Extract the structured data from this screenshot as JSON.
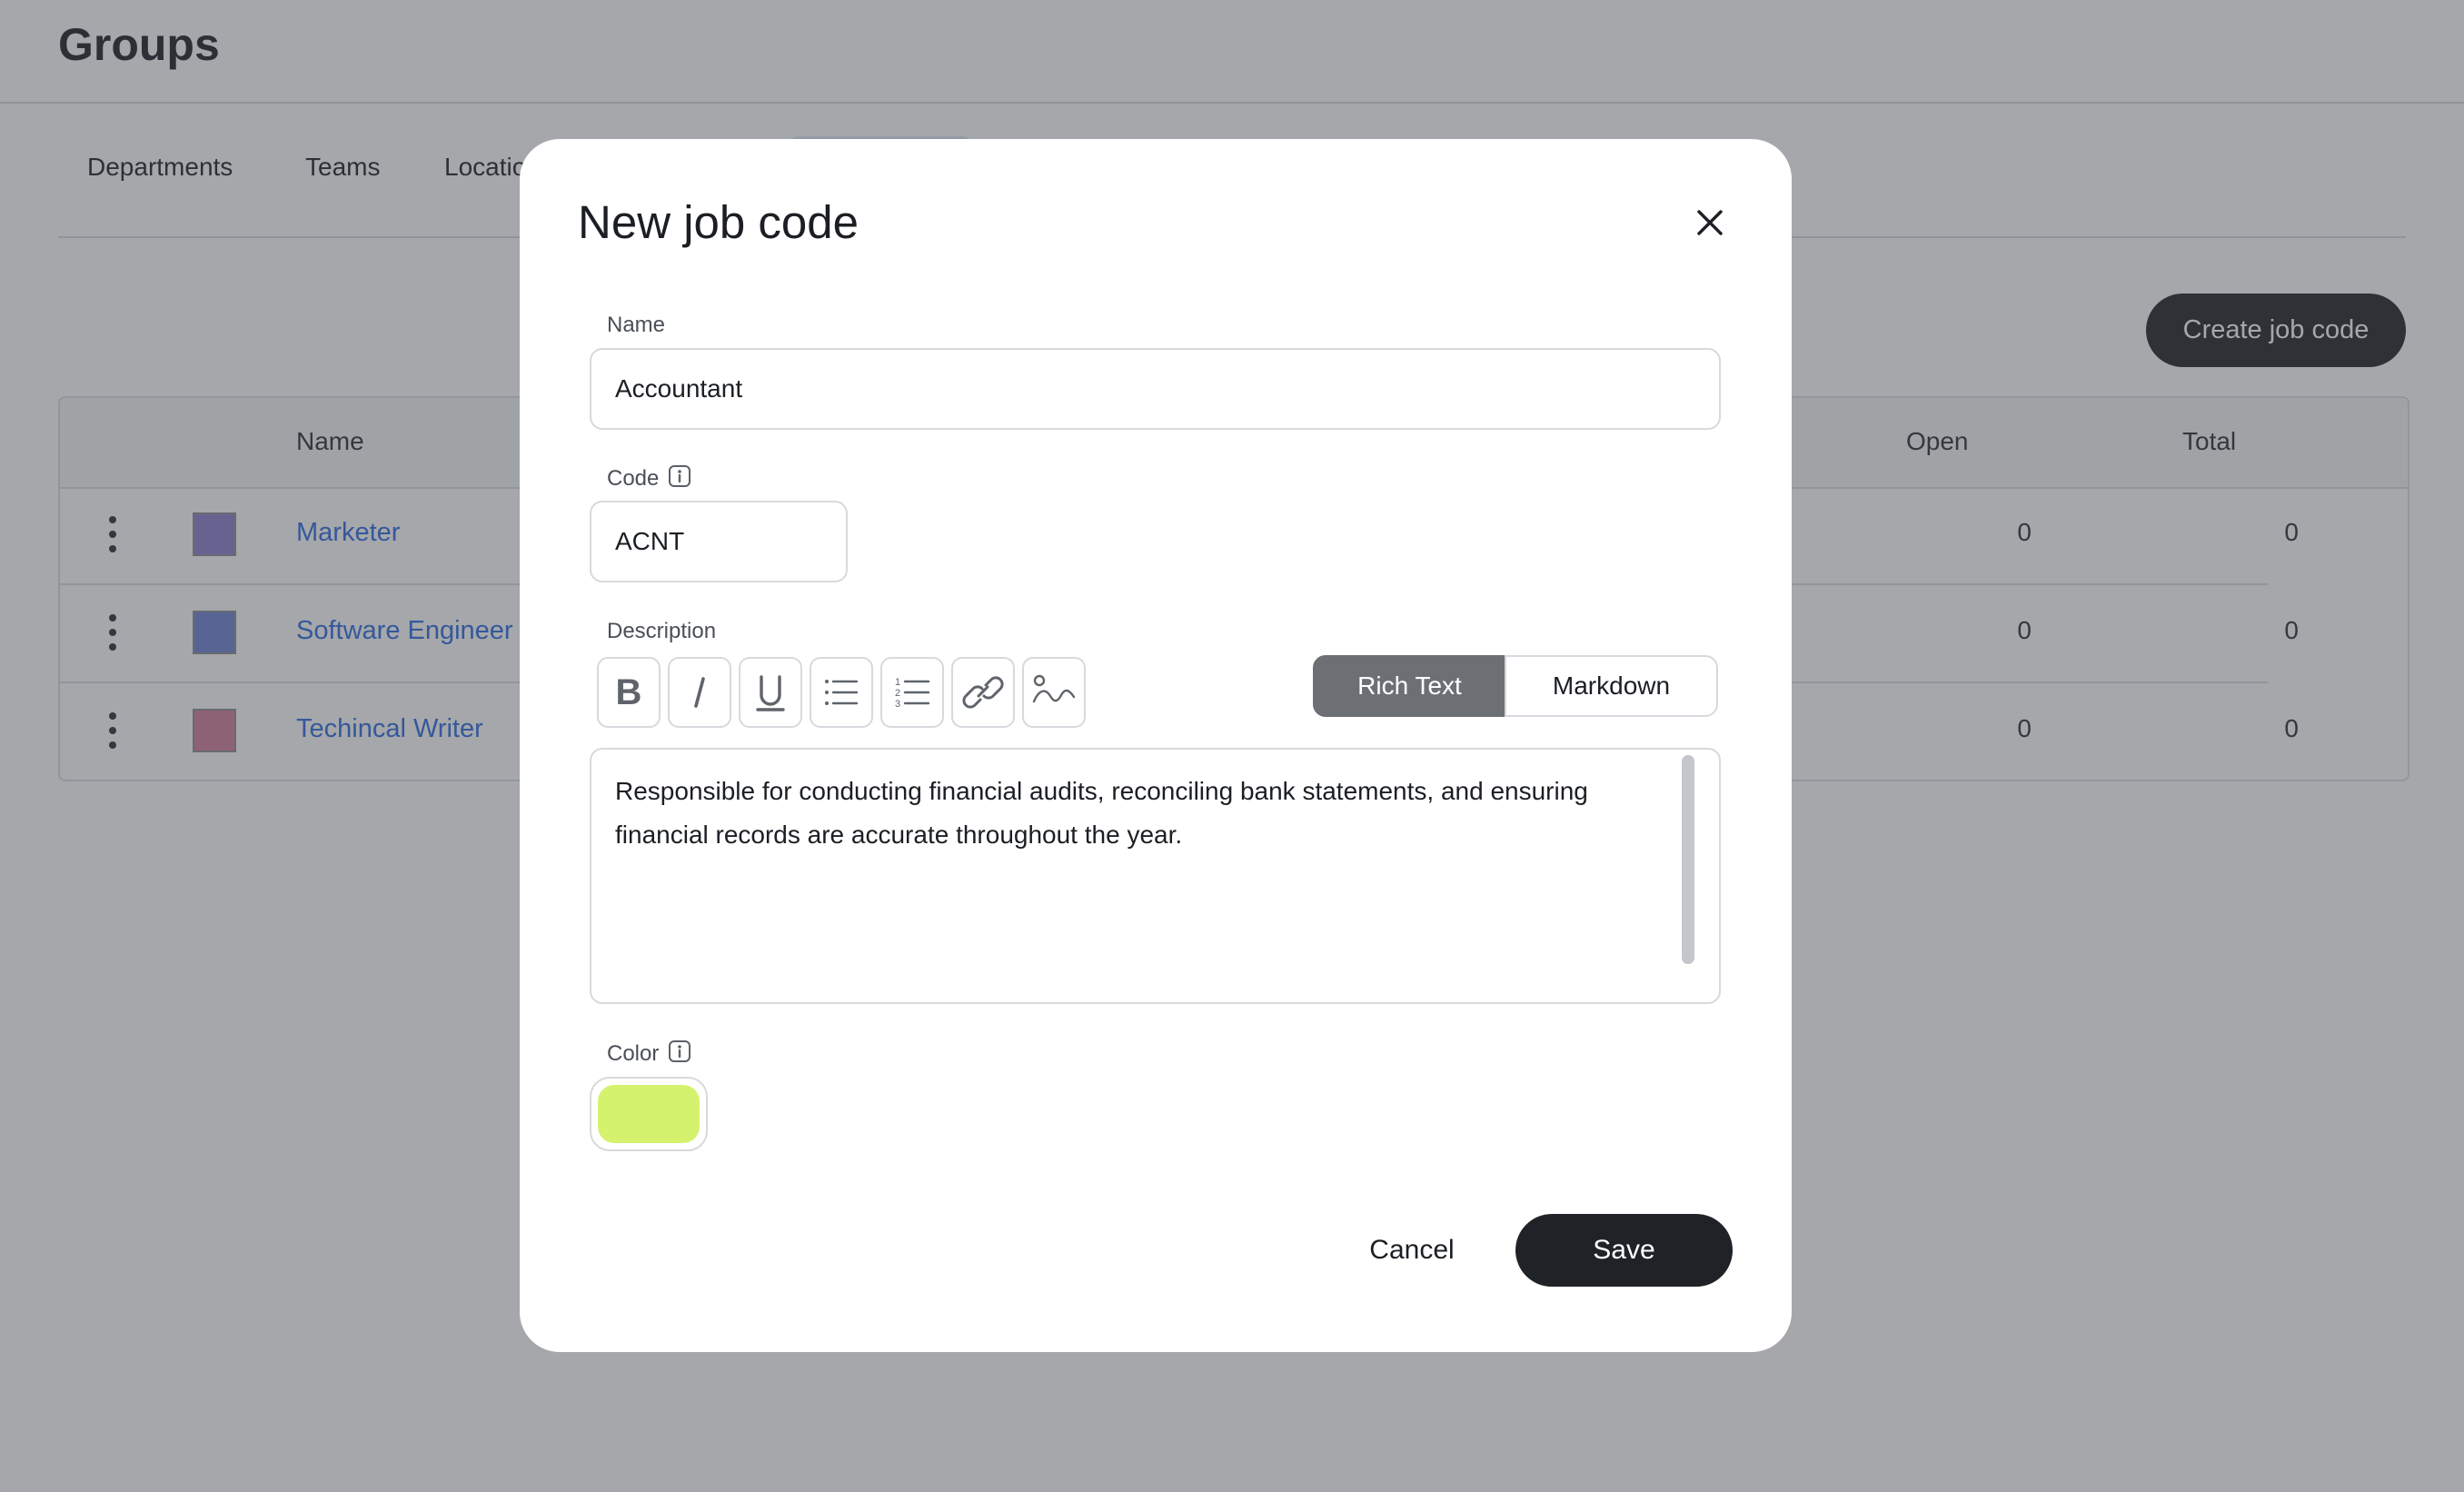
{
  "page": {
    "title": "Groups",
    "tabs": [
      {
        "label": "Departments"
      },
      {
        "label": "Teams"
      },
      {
        "label": "Locatio"
      }
    ],
    "create_button": "Create job code",
    "table": {
      "headers": {
        "name": "Name",
        "open": "Open",
        "total": "Total"
      },
      "rows": [
        {
          "name": "Marketer",
          "color": "#8b7fd0",
          "open": "0",
          "total": "0"
        },
        {
          "name": "Software Engineer",
          "color": "#6f83d6",
          "open": "0",
          "total": "0"
        },
        {
          "name": "Techincal Writer",
          "color": "#d47d9b",
          "open": "0",
          "total": "0"
        }
      ]
    }
  },
  "modal": {
    "title": "New job code",
    "name_label": "Name",
    "name_value": "Accountant",
    "code_label": "Code",
    "code_value": "ACNT",
    "description_label": "Description",
    "toolbar": {
      "bold": "bold-icon",
      "italic": "italic-icon",
      "underline": "underline-icon",
      "bullet_list": "bullet-list-icon",
      "numbered_list": "numbered-list-icon",
      "link": "link-icon",
      "signature": "signature-icon"
    },
    "mode_options": {
      "rich": "Rich Text",
      "markdown": "Markdown",
      "selected": "Rich Text"
    },
    "description_text": "Responsible for conducting financial audits, reconciling bank statements, and ensuring financial records are accurate throughout the year.",
    "color_label": "Color",
    "color_value": "#d4f26e",
    "cancel_label": "Cancel",
    "save_label": "Save"
  }
}
